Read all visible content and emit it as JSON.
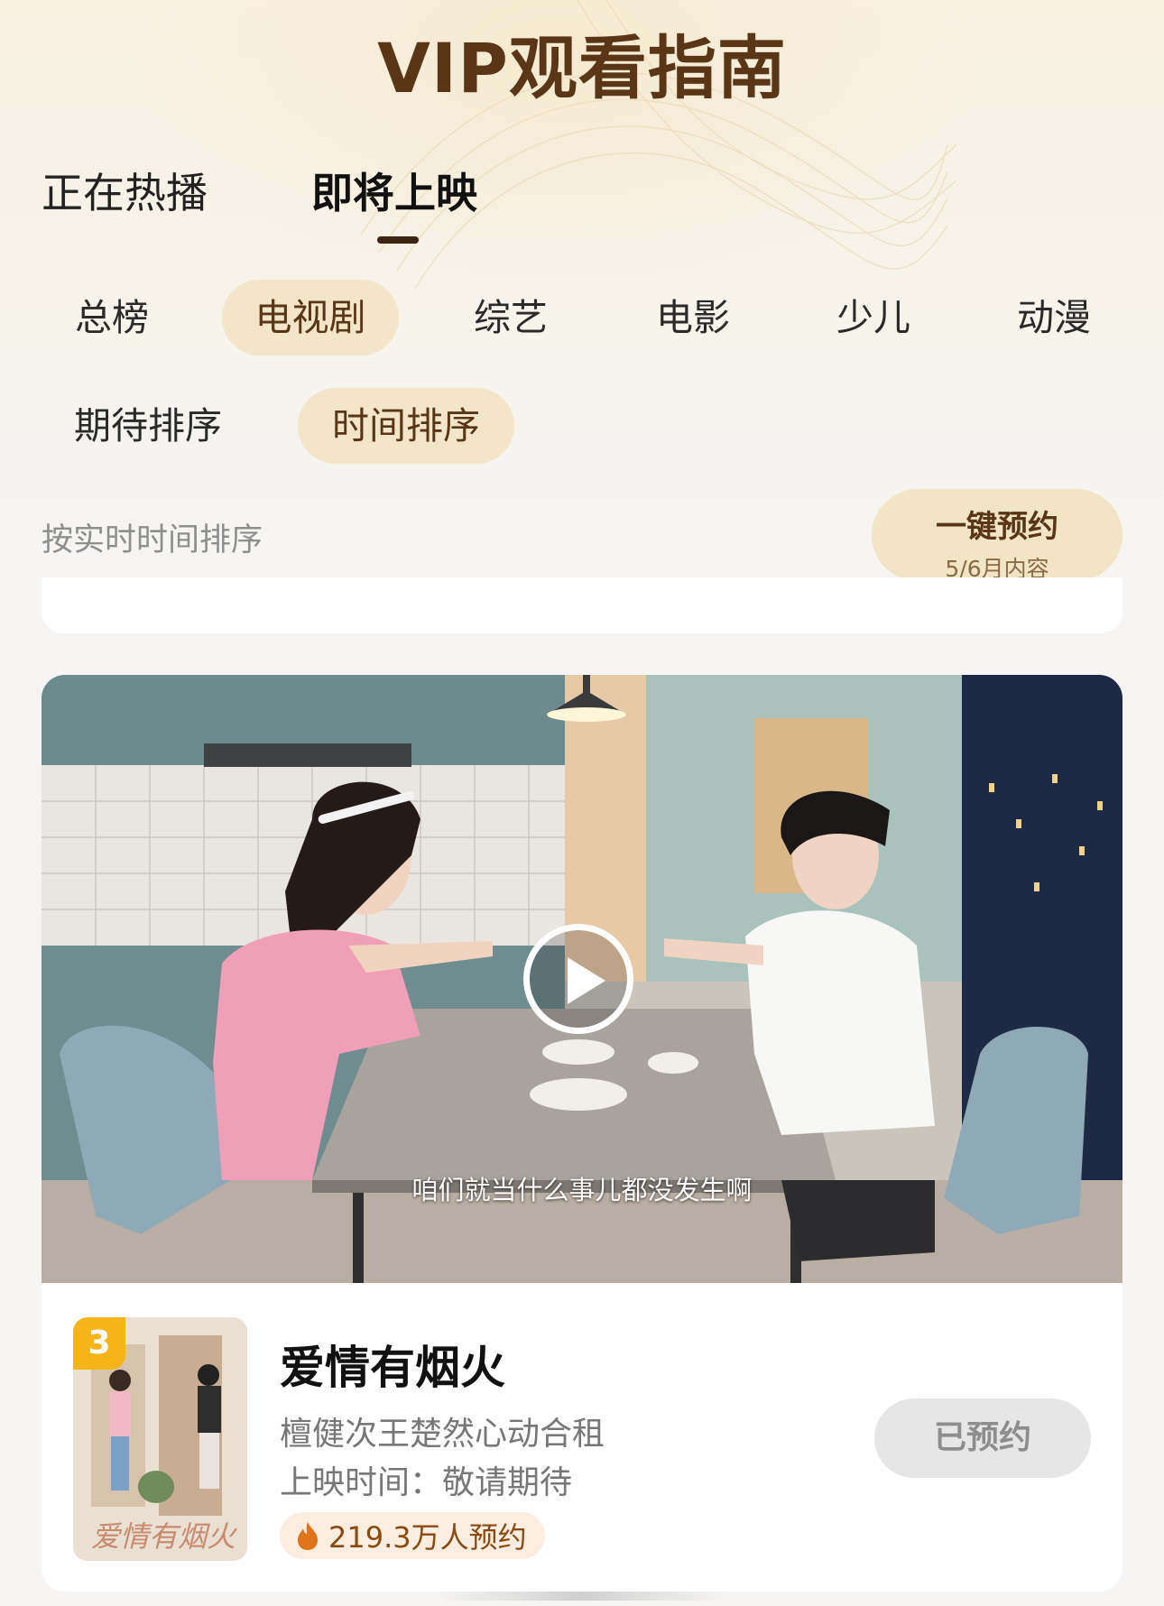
{
  "header": {
    "title": "VIP观看指南"
  },
  "main_tabs": [
    {
      "label": "正在热播",
      "active": false
    },
    {
      "label": "即将上映",
      "active": true
    }
  ],
  "category_chips": [
    {
      "label": "总榜",
      "active": false
    },
    {
      "label": "电视剧",
      "active": true
    },
    {
      "label": "综艺",
      "active": false
    },
    {
      "label": "电影",
      "active": false
    },
    {
      "label": "少儿",
      "active": false
    },
    {
      "label": "动漫",
      "active": false
    }
  ],
  "sort_chips": [
    {
      "label": "期待排序",
      "active": false
    },
    {
      "label": "时间排序",
      "active": true
    }
  ],
  "sort_hint": "按实时时间排序",
  "book_all_button": {
    "line1": "一键预约",
    "line2": "5/6月内容"
  },
  "card": {
    "video_subtitle": "咱们就当什么事儿都没发生啊",
    "rank": "3",
    "poster_title": "爱情有烟火",
    "title": "爱情有烟火",
    "description": "檀健次王楚然心动合租",
    "release": "上映时间：敬请期待",
    "booked_count": "219.3万人预约",
    "reserve_button": "已预约"
  },
  "colors": {
    "brand_brown": "#5a3616",
    "chip_active_bg": "#f3e6c8",
    "rank_badge": "#f5b418",
    "booked_pill_bg": "#fbeee0",
    "fire": "#e0741a"
  }
}
